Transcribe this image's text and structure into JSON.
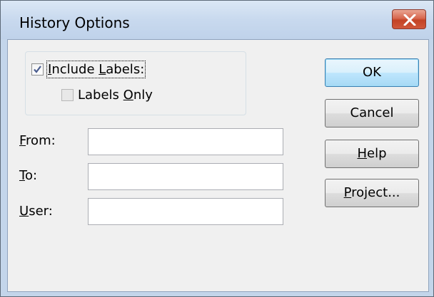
{
  "dialog": {
    "title": "History Options",
    "close_label": "close"
  },
  "options": {
    "include_labels": {
      "label": "Include Labels:",
      "pre": "",
      "key": "I",
      "post": "nclude ",
      "key2": "L",
      "post2": "abels:",
      "checked": true
    },
    "labels_only": {
      "pre": "Labels ",
      "key": "O",
      "post": "nly",
      "checked": false,
      "enabled": false
    }
  },
  "fields": {
    "from": {
      "key": "F",
      "rest": "rom:",
      "value": ""
    },
    "to": {
      "key": "T",
      "rest": "o:",
      "value": ""
    },
    "user": {
      "key": "U",
      "rest": "ser:",
      "value": ""
    }
  },
  "buttons": {
    "ok": {
      "text": "OK"
    },
    "cancel": {
      "text": "Cancel"
    },
    "help": {
      "key": "H",
      "rest": "elp"
    },
    "project": {
      "key": "P",
      "rest": "roject..."
    }
  },
  "colors": {
    "title_bar": "#c8d9ee",
    "close_button": "#c34325",
    "default_button": "#bee6fd",
    "checkmark": "#4a5d8f"
  }
}
